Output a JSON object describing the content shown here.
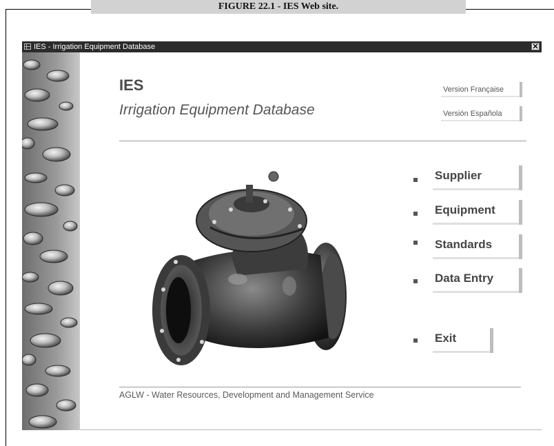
{
  "figure": {
    "caption": "FIGURE 22.1 - IES Web site."
  },
  "window": {
    "title": "IES - Irrigation Equipment Database",
    "close_glyph": "✕"
  },
  "header": {
    "title": "IES",
    "subtitle": "Irrigation Equipment Database"
  },
  "language_buttons": [
    {
      "label": "Version Française"
    },
    {
      "label": "Versión Española"
    }
  ],
  "menu": [
    {
      "label": "Supplier"
    },
    {
      "label": "Equipment"
    },
    {
      "label": "Standards"
    },
    {
      "label": "Data Entry"
    },
    {
      "label": "Exit"
    }
  ],
  "footer": {
    "text": "AGLW - Water Resources, Development and Management Service"
  }
}
